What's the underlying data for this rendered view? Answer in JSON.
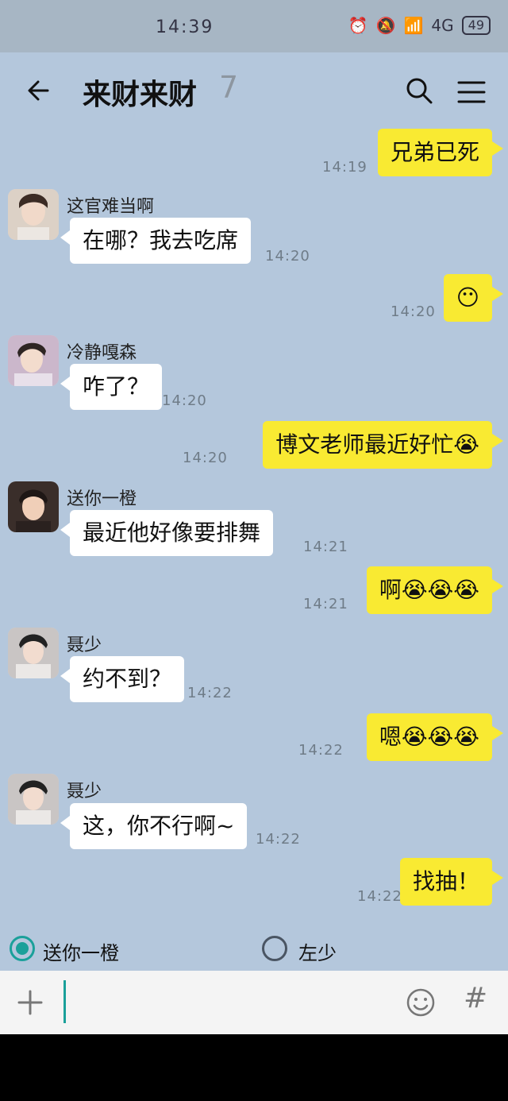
{
  "status": {
    "time": "14:39",
    "battery": "49",
    "network": "4G"
  },
  "header": {
    "title": "来财来财",
    "count": "7"
  },
  "messages": [
    {
      "side": "right",
      "text": "兄弟已死",
      "time": "14:19"
    },
    {
      "side": "left",
      "sender": "这官难当啊",
      "text": "在哪？我去吃席",
      "time": "14:20"
    },
    {
      "side": "right",
      "text": "😶",
      "time": "14:20"
    },
    {
      "side": "left",
      "sender": "冷静嘎森",
      "text": "咋了？",
      "time": "14:20"
    },
    {
      "side": "right",
      "text": "博文老师最近好忙😭",
      "time": "14:20"
    },
    {
      "side": "left",
      "sender": "送你一橙",
      "text": "最近他好像要排舞",
      "time": "14:21"
    },
    {
      "side": "right",
      "text": "啊😭😭😭",
      "time": "14:21"
    },
    {
      "side": "left",
      "sender": "聂少",
      "text": "约不到？",
      "time": "14:22"
    },
    {
      "side": "right",
      "text": "嗯😭😭😭",
      "time": "14:22"
    },
    {
      "side": "left",
      "sender": "聂少",
      "text": "这，你不行啊~",
      "time": "14:22"
    },
    {
      "side": "right",
      "text": "找抽！",
      "time": "14:22"
    }
  ],
  "choices": [
    {
      "label": "送你一橙",
      "selected": true
    },
    {
      "label": "左少",
      "selected": false
    }
  ],
  "colors": {
    "background": "#b4c7dc",
    "right_bubble": "#f9ea32",
    "left_bubble": "#ffffff",
    "radio_accent": "#1aa09a"
  }
}
